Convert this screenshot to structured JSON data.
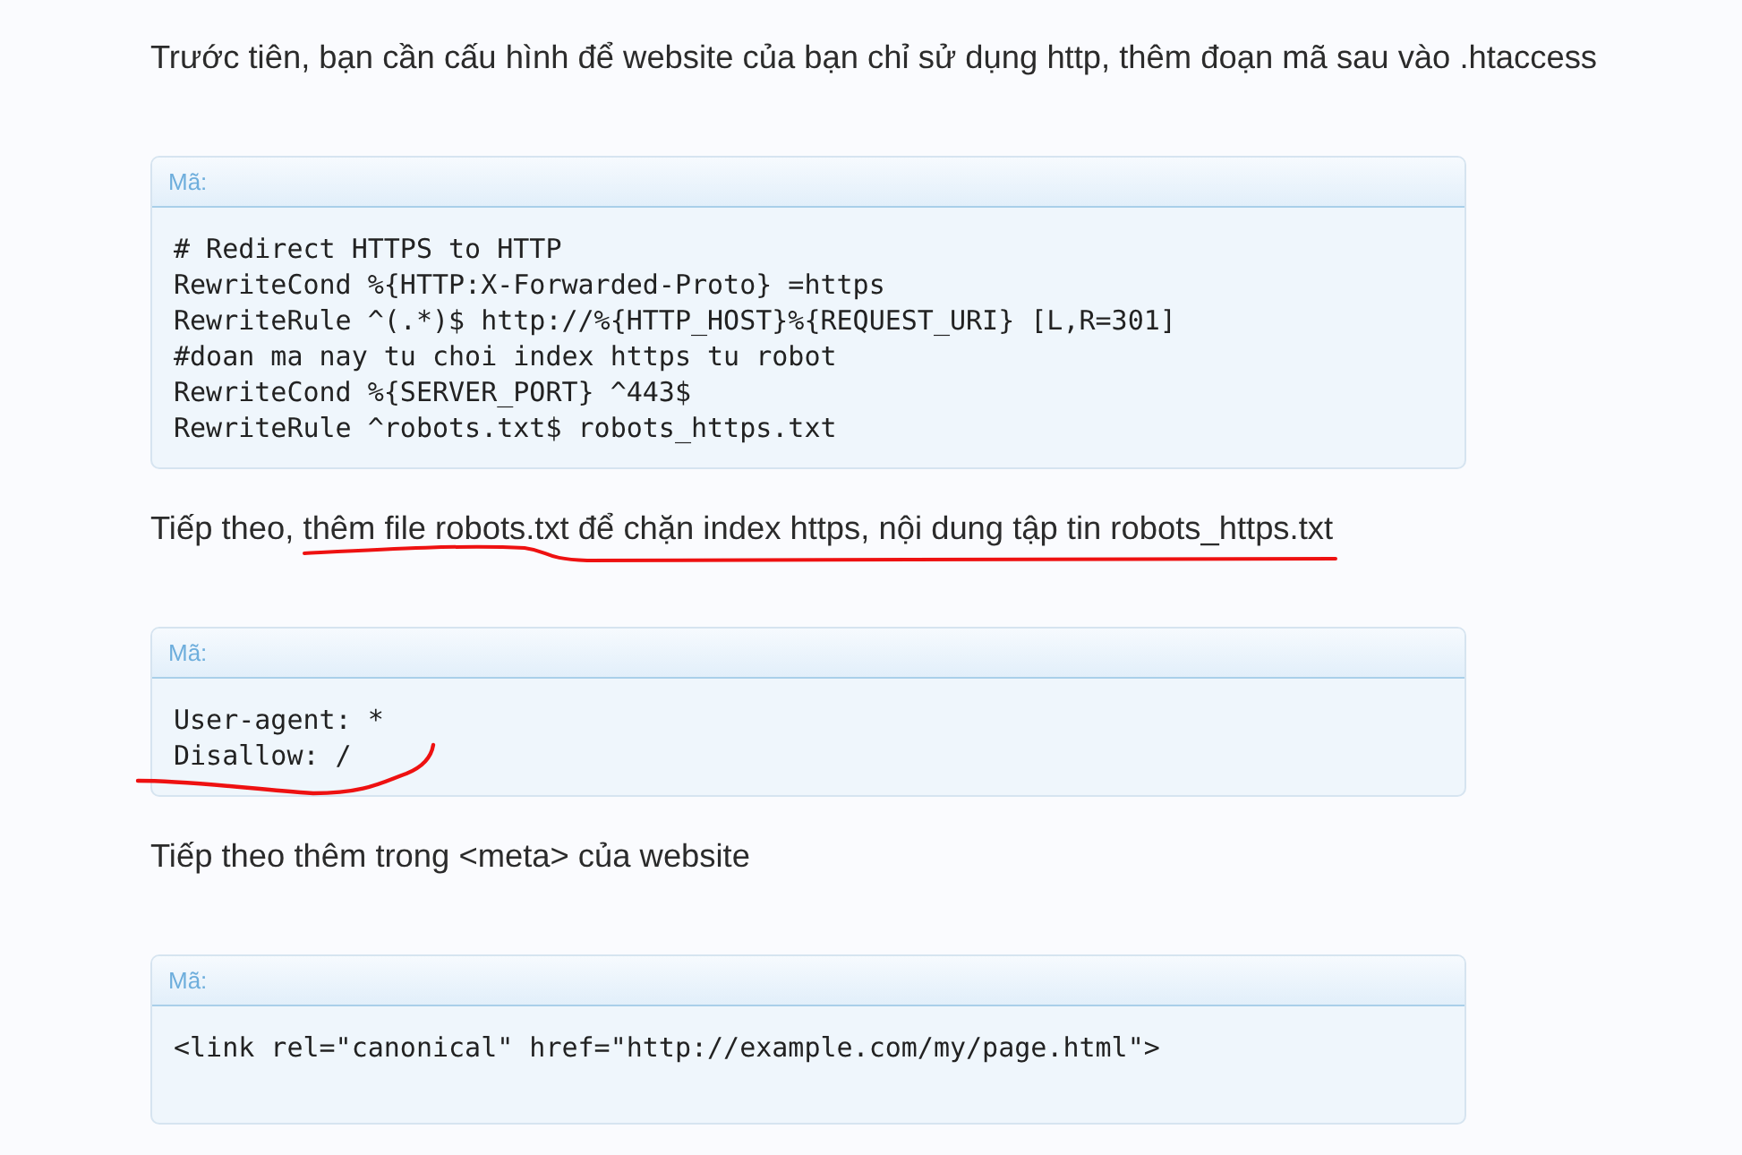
{
  "content": [
    {
      "kind": "paragraph",
      "text": "Trước tiên, bạn cần cấu hình để website của bạn chỉ sử dụng http, thêm đoạn mã sau vào .htaccess"
    },
    {
      "kind": "code",
      "label": "Mã:",
      "lines": [
        "# Redirect HTTPS to HTTP",
        "RewriteCond %{HTTP:X-Forwarded-Proto} =https",
        "RewriteRule ^(.*)$ http://%{HTTP_HOST}%{REQUEST_URI} [L,R=301]",
        "#doan ma nay tu choi index https tu robot",
        "RewriteCond %{SERVER_PORT} ^443$",
        "RewriteRule ^robots.txt$ robots_https.txt"
      ]
    },
    {
      "kind": "paragraph",
      "text": "Tiếp theo, thêm file robots.txt để chặn index https, nội dung tập tin robots_https.txt"
    },
    {
      "kind": "code",
      "label": "Mã:",
      "lines": [
        "User-agent: *",
        "Disallow: /"
      ]
    },
    {
      "kind": "paragraph",
      "text": "Tiếp theo thêm trong <meta> của website"
    },
    {
      "kind": "code",
      "label": "Mã:",
      "lines": [
        "<link rel=\"canonical\" href=\"http://example.com/my/page.html\">"
      ]
    }
  ],
  "strokes": [
    {
      "kind": "underline"
    },
    {
      "kind": "hook"
    }
  ]
}
